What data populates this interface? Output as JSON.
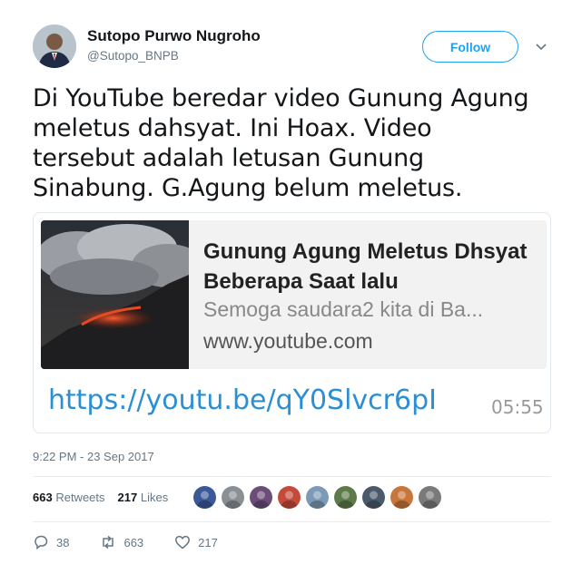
{
  "author": {
    "name": "Sutopo Purwo Nugroho",
    "handle": "@Sutopo_BNPB"
  },
  "follow_label": "Follow",
  "tweet": {
    "text": "Di YouTube beredar video Gunung Agung meletus dahsyat. Ini Hoax. Video tersebut adalah letusan Gunung Sinabung. G.Agung belum meletus."
  },
  "card": {
    "title": "Gunung Agung Meletus Dhsyat Beberapa Saat lalu",
    "description": "Semoga saudara2 kita di Ba...",
    "domain": "www.youtube.com",
    "link": "https://youtu.be/qY0Slvcr6pI",
    "time": "05:55"
  },
  "timestamp": "9:22 PM - 23 Sep 2017",
  "stats": {
    "retweets_count": "663",
    "retweets_label": "Retweets",
    "likes_count": "217",
    "likes_label": "Likes"
  },
  "likers": [
    "#3b5998",
    "#8a8f94",
    "#6b4d7a",
    "#c44a3a",
    "#7c9ab5",
    "#5d7a4a",
    "#4a5a6a",
    "#c9763a",
    "#7a7a7a"
  ],
  "actions": {
    "replies": "38",
    "retweets": "663",
    "likes": "217"
  },
  "colors": {
    "accent": "#1da1f2",
    "muted": "#657786",
    "link": "#2a8fd4"
  }
}
